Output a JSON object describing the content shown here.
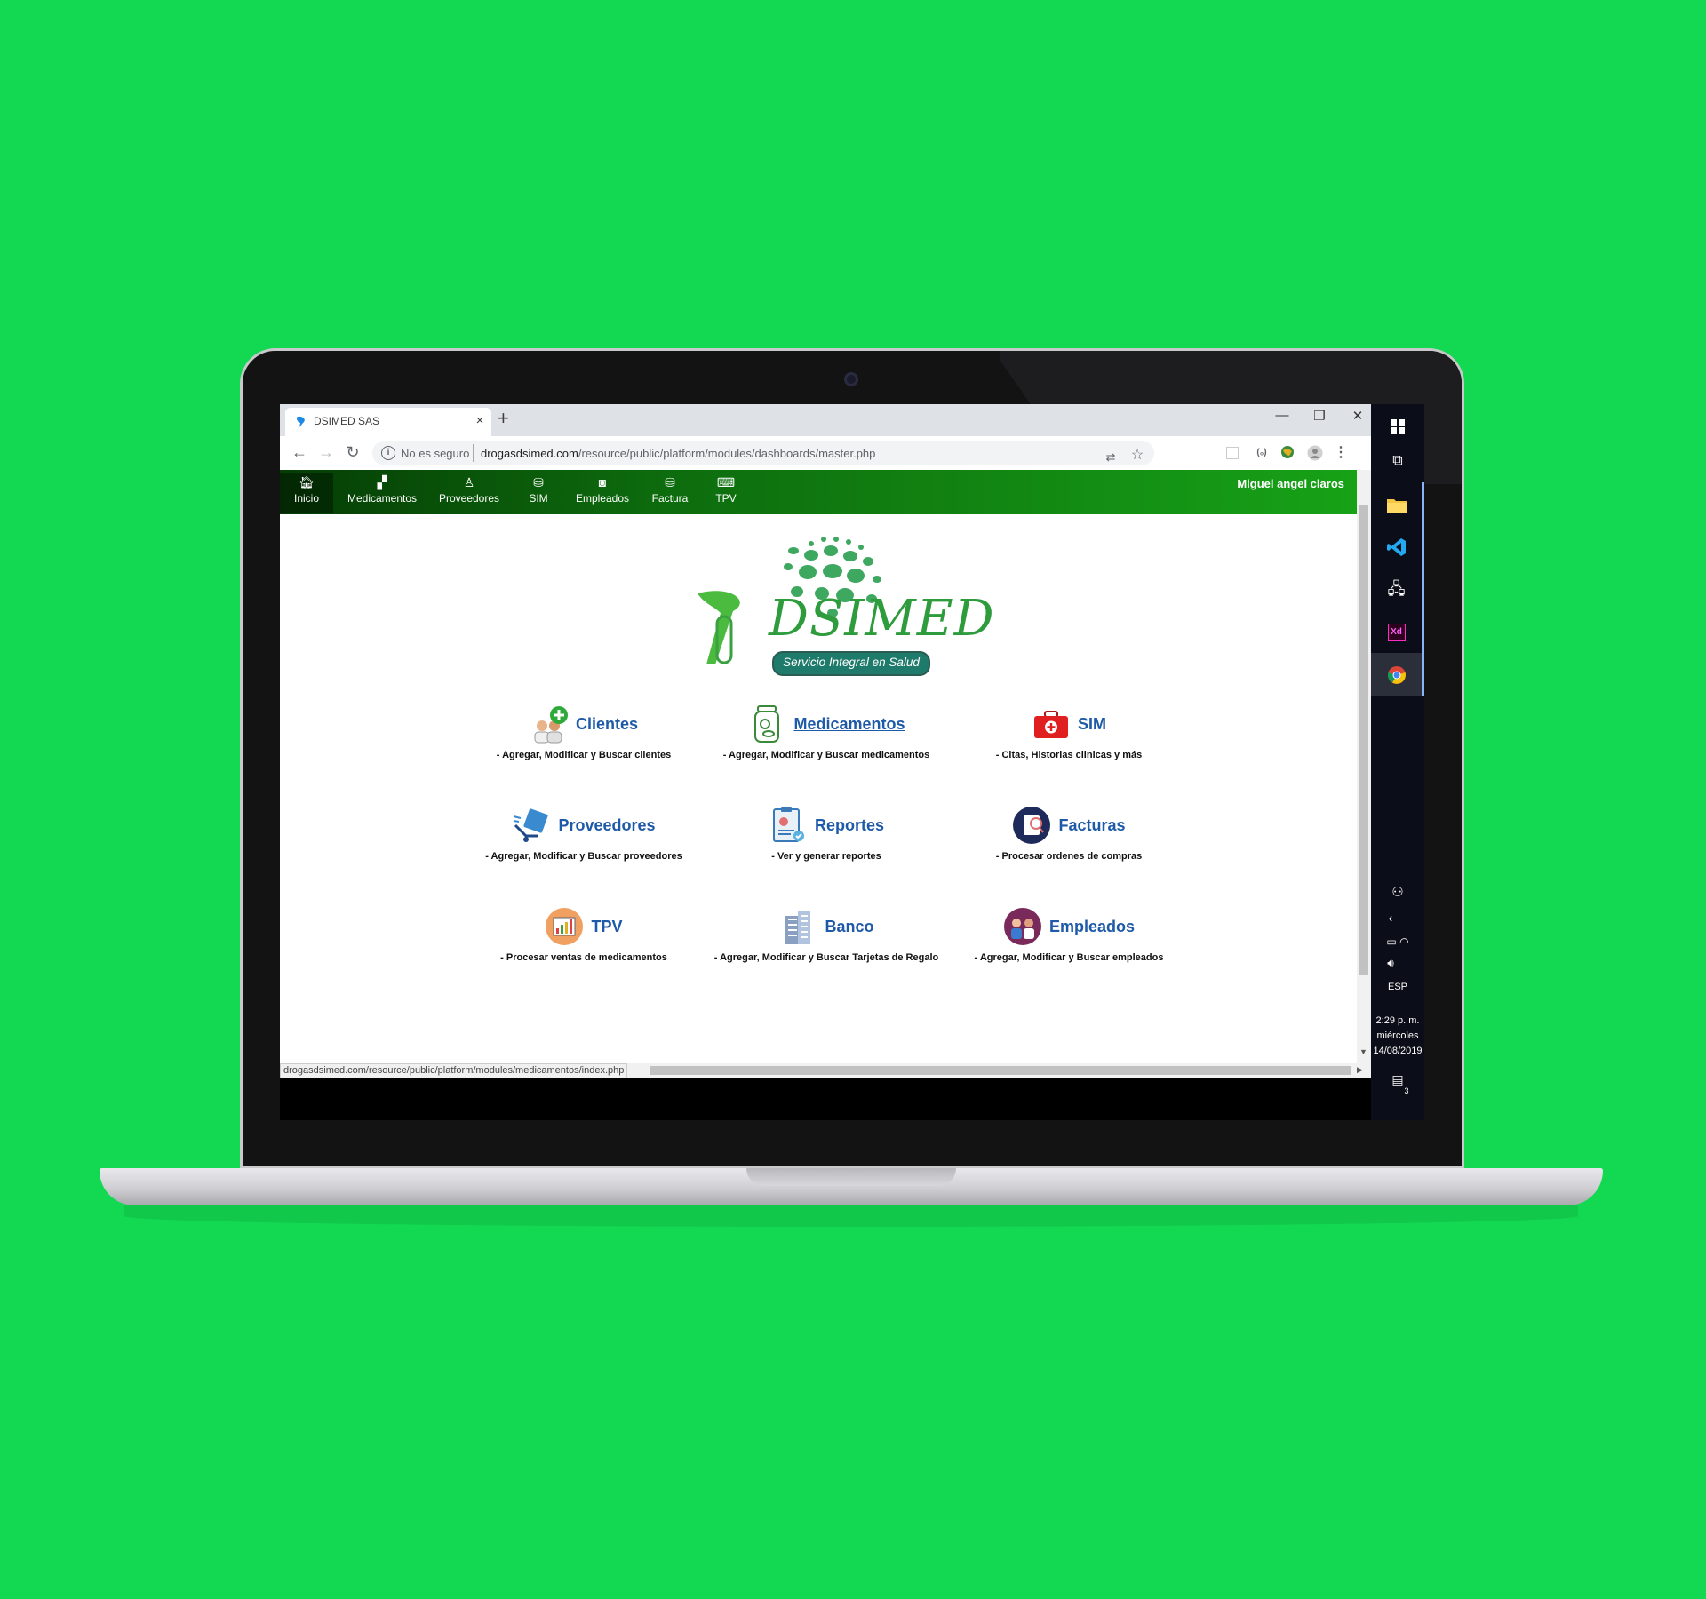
{
  "browser": {
    "tab_title": "DSIMED SAS",
    "tab_close": "×",
    "new_tab": "+",
    "minimize": "—",
    "restore": "❐",
    "close": "✕",
    "not_secure": "No es seguro",
    "url_host": "drogasdsimed.com",
    "url_path": "/resource/public/platform/modules/dashboards/master.php",
    "status_url": "drogasdsimed.com/resource/public/platform/modules/medicamentos/index.php"
  },
  "nav": {
    "items": [
      {
        "label": "Inicio",
        "icon": "home-icon"
      },
      {
        "label": "Medicamentos",
        "icon": "boxes-icon"
      },
      {
        "label": "Proveedores",
        "icon": "person-icon"
      },
      {
        "label": "SIM",
        "icon": "database-icon"
      },
      {
        "label": "Empleados",
        "icon": "camera-icon"
      },
      {
        "label": "Factura",
        "icon": "database-icon"
      },
      {
        "label": "TPV",
        "icon": "register-icon"
      }
    ],
    "user": "Miguel angel claros"
  },
  "logo": {
    "text": "DSIMED",
    "tagline": "Servicio Integral en Salud"
  },
  "modules": [
    {
      "title": "Clientes",
      "desc": "- Agregar, Modificar y Buscar clientes",
      "icon": "clients-icon"
    },
    {
      "title": "Medicamentos",
      "desc": "- Agregar, Modificar y Buscar medicamentos",
      "icon": "medicine-jar-icon"
    },
    {
      "title": "SIM",
      "desc": "- Citas, Historias clinicas y más",
      "icon": "first-aid-kit-icon"
    },
    {
      "title": "Proveedores",
      "desc": "- Agregar, Modificar y Buscar proveedores",
      "icon": "delivery-icon"
    },
    {
      "title": "Reportes",
      "desc": "- Ver y generar reportes",
      "icon": "report-icon"
    },
    {
      "title": "Facturas",
      "desc": "- Procesar ordenes de compras",
      "icon": "invoice-icon"
    },
    {
      "title": "TPV",
      "desc": "- Procesar ventas de medicamentos",
      "icon": "chart-register-icon"
    },
    {
      "title": "Banco",
      "desc": "- Agregar, Modificar y Buscar Tarjetas de Regalo",
      "icon": "bank-building-icon"
    },
    {
      "title": "Empleados",
      "desc": "- Agregar, Modificar y Buscar empleados",
      "icon": "employees-icon"
    }
  ],
  "taskbar": {
    "lang": "ESP",
    "time": "2:29 p. m.",
    "day": "miércoles",
    "date": "14/08/2019",
    "notif_count": "3"
  },
  "colors": {
    "background": "#13d952",
    "nav_green": "#17a217",
    "module_title": "#1e5aa8"
  }
}
